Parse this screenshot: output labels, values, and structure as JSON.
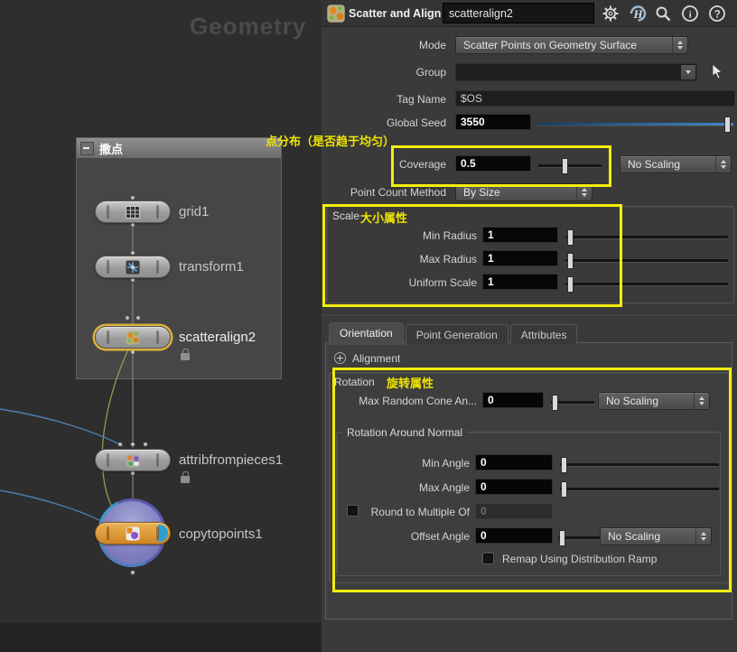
{
  "left_pane": {
    "watermark": "Geometry",
    "network_box_title": "撒点",
    "nodes": [
      {
        "name": "grid1"
      },
      {
        "name": "transform1"
      },
      {
        "name": "scatteralign2"
      },
      {
        "name": "attribfrompieces1"
      },
      {
        "name": "copytopoints1"
      }
    ]
  },
  "header": {
    "title": "Scatter and Align",
    "name_value": "scatteralign2",
    "icons": [
      "gear",
      "houdini-logo",
      "search",
      "info",
      "help"
    ]
  },
  "params": {
    "mode": {
      "label": "Mode",
      "value": "Scatter Points on Geometry Surface"
    },
    "group": {
      "label": "Group",
      "value": ""
    },
    "tag_name": {
      "label": "Tag Name",
      "value": "$OS"
    },
    "global_seed": {
      "label": "Global Seed",
      "value": "3550"
    },
    "coverage": {
      "label": "Coverage",
      "value": "0.5",
      "scaling": "No Scaling"
    },
    "point_count_method": {
      "label": "Point Count Method",
      "value": "By Size"
    },
    "scale": {
      "title": "Scale",
      "min_radius": {
        "label": "Min Radius",
        "value": "1"
      },
      "max_radius": {
        "label": "Max Radius",
        "value": "1"
      },
      "uniform_scale": {
        "label": "Uniform Scale",
        "value": "1"
      }
    },
    "tabs": [
      "Orientation",
      "Point Generation",
      "Attributes"
    ],
    "alignment_label": "Alignment",
    "rotation": {
      "title": "Rotation",
      "max_random_cone": {
        "label": "Max Random Cone An...",
        "value": "0",
        "scaling": "No Scaling"
      },
      "around_normal": {
        "title": "Rotation Around Normal",
        "min_angle": {
          "label": "Min Angle",
          "value": "0"
        },
        "max_angle": {
          "label": "Max Angle",
          "value": "0"
        },
        "round_to_multiple": {
          "label": "Round to Multiple Of",
          "value": "0"
        },
        "offset_angle": {
          "label": "Offset Angle",
          "value": "0",
          "scaling": "No Scaling"
        },
        "remap_label": "Remap Using Distribution Ramp"
      }
    }
  },
  "annotations": {
    "coverage_note": "点分布（是否趋于均匀）",
    "scale_note": "大小属性",
    "rotation_note": "旋转属性",
    "highlight_color": "#f2ee0a"
  },
  "colors": {
    "selection": "#ddb23a",
    "seed_slider_blue": "#3f88c9"
  }
}
